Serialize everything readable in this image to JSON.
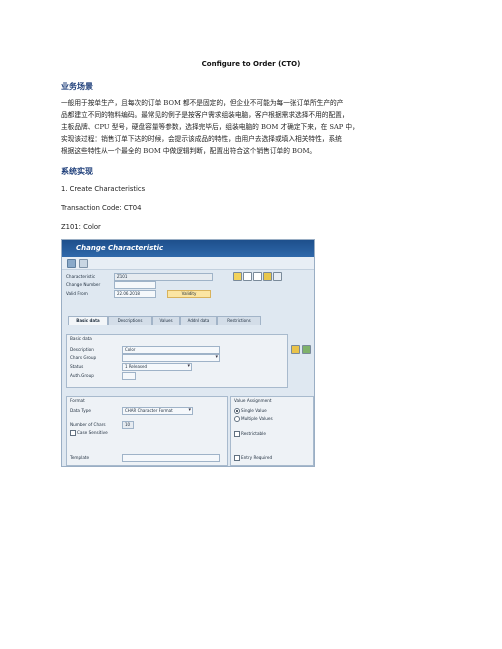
{
  "document": {
    "title": "Configure to Order (CTO)",
    "section1_heading": "业务场景",
    "paragraph_lines": [
      "一般用于按单生产，且每次的订单 BOM 都不是固定的，但企业不可能为每一张订单所生产的产",
      "品都建立不同的物料编码。最常见的例子是按客户需求组装电脑，客户根据需求选择不用的配置，",
      "主板品牌、CPU 型号，硬盘容量等参数，选择完毕后，组装电脑的 BOM 才确定下来，在 SAP 中，",
      "实现该过程：销售订单下达的时候，会提示该成品的特性，由用户去选择或填入相关特性，系统",
      "根据这些特性从一个最全的 BOM 中做逻辑判断，配置出符合这个销售订单的 BOM。"
    ],
    "section2_heading": "系统实现",
    "step1": "1. Create Characteristics",
    "transaction": "Transaction Code: CT04",
    "characteristic_line": "Z101: Color"
  },
  "sap": {
    "window_title": "Change Characteristic",
    "header": {
      "characteristic_label": "Characteristic",
      "characteristic_value": "Z101",
      "change_number_label": "Change Number",
      "change_number_value": "",
      "valid_from_label": "Valid From",
      "valid_from_value": "22.06.2018",
      "validity_button": "Validity"
    },
    "tabs": [
      "Basic data",
      "Descriptions",
      "Values",
      "Addnl data",
      "Restrictions"
    ],
    "basic_data": {
      "group_title": "Basic data",
      "description_label": "Description",
      "description_value": "Color",
      "char_group_label": "Chars Group",
      "char_group_value": "",
      "status_label": "Status",
      "status_value": "1 Released",
      "auth_group_label": "Auth.Group",
      "auth_group_value": ""
    },
    "format": {
      "group_title": "Format",
      "data_type_label": "Data Type",
      "data_type_value": "CHAR Character Format",
      "num_chars_label": "Number of Chars",
      "num_chars_value": "10",
      "case_sensitive_label": "Case Sensitive",
      "template_label": "Template",
      "template_value": ""
    },
    "value_assignment": {
      "group_title": "Value Assignment",
      "single_value": "Single Value",
      "multiple_values": "Multiple Values",
      "restrictable": "Restrictable",
      "entry_required": "Entry Required"
    },
    "colors": {
      "title_bar": "#1d4f8c",
      "panel": "#dfe8f1",
      "validity_button": "#fbe5a3"
    }
  }
}
